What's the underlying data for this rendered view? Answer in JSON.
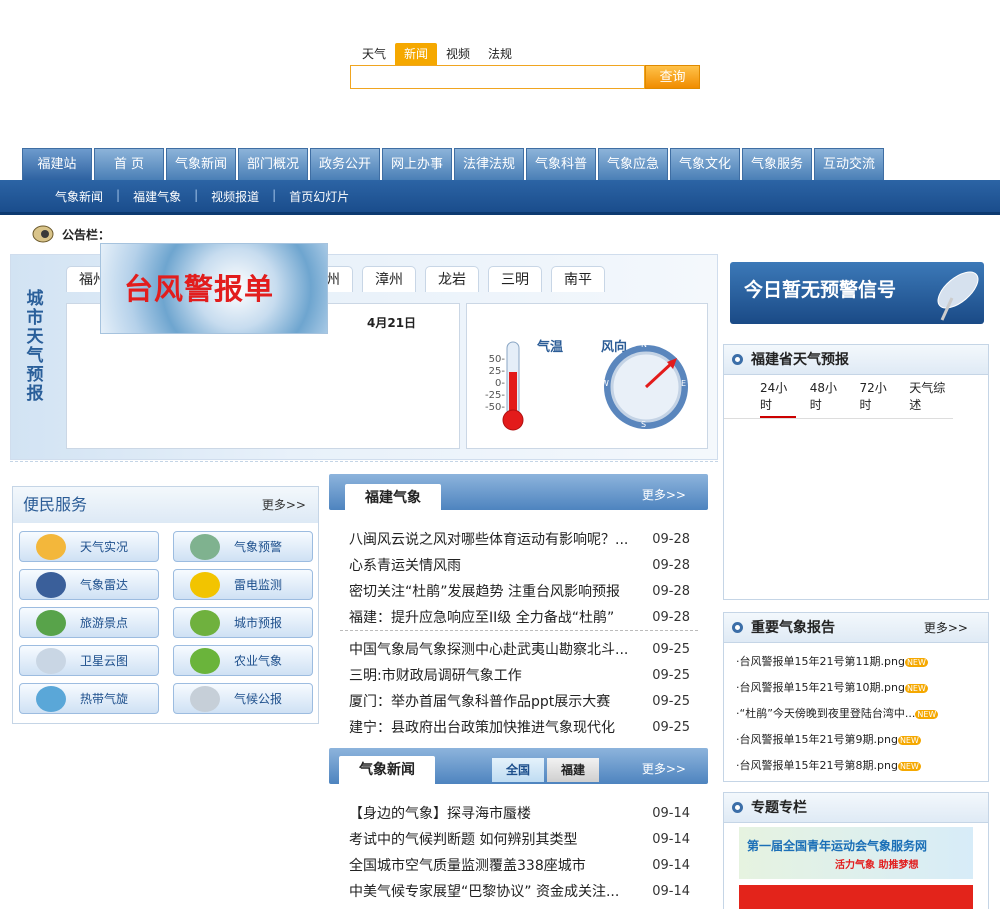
{
  "search": {
    "tabs": [
      "天气",
      "新闻",
      "视频",
      "法规"
    ],
    "active_tab": "新闻",
    "button": "查询"
  },
  "nav": {
    "items": [
      "福建站",
      "首 页",
      "气象新闻",
      "部门概况",
      "政务公开",
      "网上办事",
      "法律法规",
      "气象科普",
      "气象应急",
      "气象文化",
      "气象服务",
      "互动交流"
    ]
  },
  "subnav": {
    "items": [
      "气象新闻",
      "福建气象",
      "视频报道",
      "首页幻灯片"
    ]
  },
  "notice": {
    "label": "公告栏："
  },
  "city_weather": {
    "title": "城市天气预报",
    "tabs": [
      "福州",
      "泉州",
      "漳州",
      "龙岩",
      "三明",
      "南平"
    ],
    "date": "4月21日",
    "temp_label": "气温",
    "wind_label": "风向",
    "temp_ticks": [
      "50-",
      "25-",
      "0-",
      "-25-",
      "-50-"
    ],
    "compass": [
      "N",
      "E",
      "S",
      "W"
    ]
  },
  "typhoon_banner": {
    "text": "台风警报单"
  },
  "warning": {
    "text": "今日暂无预警信号"
  },
  "forecast": {
    "title": "福建省天气预报",
    "tabs": [
      "24小时",
      "48小时",
      "72小时",
      "天气综述"
    ]
  },
  "services": {
    "title": "便民服务",
    "more": "更多>>",
    "items": [
      {
        "label": "天气实况",
        "icon": "sun-cloud-icon",
        "color": "#f3b73b"
      },
      {
        "label": "气象预警",
        "icon": "thermometer-icon",
        "color": "#7fb28f"
      },
      {
        "label": "气象雷达",
        "icon": "radar-icon",
        "color": "#3a5f9a"
      },
      {
        "label": "雷电监测",
        "icon": "lightning-icon",
        "color": "#f2c400"
      },
      {
        "label": "旅游景点",
        "icon": "palm-tree-icon",
        "color": "#58a34a"
      },
      {
        "label": "城市预报",
        "icon": "city-icon",
        "color": "#6fb13e"
      },
      {
        "label": "卫星云图",
        "icon": "satellite-icon",
        "color": "#c9d6e4"
      },
      {
        "label": "农业气象",
        "icon": "leaf-icon",
        "color": "#6ab43b"
      },
      {
        "label": "热带气旋",
        "icon": "cyclone-icon",
        "color": "#5aa7d8"
      },
      {
        "label": "气候公报",
        "icon": "megaphone-icon",
        "color": "#c6cfd8"
      }
    ]
  },
  "fujian_weather": {
    "title": "福建气象",
    "more": "更多>>",
    "group1": [
      {
        "title": "八闽风云说之风对哪些体育运动有影响呢？...",
        "date": "09-28"
      },
      {
        "title": "心系青运关情风雨",
        "date": "09-28"
      },
      {
        "title": "密切关注“杜鹃”发展趋势 注重台风影响预报",
        "date": "09-28"
      },
      {
        "title": "福建：提升应急响应至II级 全力备战“杜鹃”",
        "date": "09-28"
      }
    ],
    "group2": [
      {
        "title": "中国气象局气象探测中心赴武夷山勘察北斗...",
        "date": "09-25"
      },
      {
        "title": "三明:市财政局调研气象工作",
        "date": "09-25"
      },
      {
        "title": "厦门：举办首届气象科普作品ppt展示大赛",
        "date": "09-25"
      },
      {
        "title": "建宁：县政府出台政策加快推进气象现代化",
        "date": "09-25"
      }
    ]
  },
  "weather_news": {
    "title": "气象新闻",
    "tabs": [
      "全国",
      "福建"
    ],
    "more": "更多>>",
    "items": [
      {
        "title": "【身边的气象】探寻海市蜃楼",
        "date": "09-14"
      },
      {
        "title": "考试中的气候判断题 如何辨别其类型",
        "date": "09-14"
      },
      {
        "title": "全国城市空气质量监测覆盖338座城市",
        "date": "09-14"
      },
      {
        "title": "中美气候专家展望“巴黎协议” 资金成关注...",
        "date": "09-14"
      }
    ]
  },
  "reports": {
    "title": "重要气象报告",
    "more": "更多>>",
    "new_badge": "NEW",
    "items": [
      "台风警报单15年21号第11期.png",
      "台风警报单15年21号第10期.png",
      "“杜鹃”今天傍晚到夜里登陆台湾中...",
      "台风警报单15年21号第9期.png",
      "台风警报单15年21号第8期.png"
    ]
  },
  "special": {
    "title": "专题专栏",
    "banner1_title": "第一届全国青年运动会气象服务网",
    "banner1_sub": "活力气象 助推梦想"
  }
}
